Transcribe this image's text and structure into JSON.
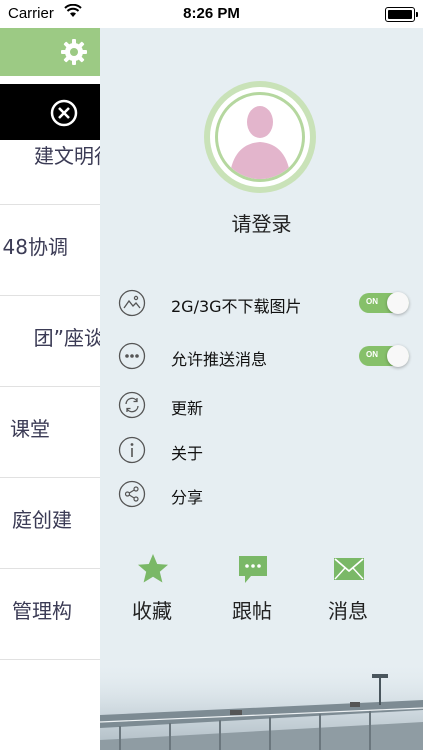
{
  "status_bar": {
    "carrier": "Carrier",
    "time": "8:26 PM"
  },
  "colors": {
    "accent_green": "#9cca84",
    "toggle_green": "#86c06a",
    "drawer_bg": "#e6eef2"
  },
  "left_panel": {
    "items": [
      "建文明行",
      "48协调",
      "团”座谈",
      "课堂",
      "庭创建",
      "管理构"
    ]
  },
  "drawer": {
    "login_label": "请登录",
    "settings": [
      {
        "label": "2G/3G不下载图片",
        "icon": "image-icon",
        "toggle": "ON"
      },
      {
        "label": "允许推送消息",
        "icon": "more-dots-icon",
        "toggle": "ON"
      },
      {
        "label": "更新",
        "icon": "refresh-icon"
      },
      {
        "label": "关于",
        "icon": "info-icon"
      },
      {
        "label": "分享",
        "icon": "share-icon"
      }
    ],
    "quick_actions": [
      {
        "label": "收藏",
        "icon": "star-icon"
      },
      {
        "label": "跟帖",
        "icon": "comment-icon"
      },
      {
        "label": "消息",
        "icon": "mail-icon"
      }
    ]
  }
}
